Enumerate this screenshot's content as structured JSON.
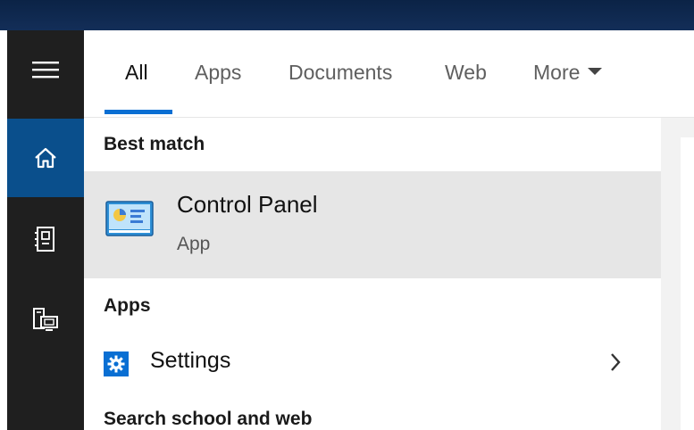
{
  "nav": {
    "items": [
      {
        "name": "hamburger-menu"
      },
      {
        "name": "home",
        "active": true
      },
      {
        "name": "notebook"
      },
      {
        "name": "devices"
      }
    ]
  },
  "tabs": [
    {
      "label": "All",
      "active": true
    },
    {
      "label": "Apps"
    },
    {
      "label": "Documents"
    },
    {
      "label": "Web"
    },
    {
      "label": "More"
    }
  ],
  "results": {
    "best_match_heading": "Best match",
    "best_match": {
      "title": "Control Panel",
      "subtitle": "App",
      "icon": "control-panel-icon"
    },
    "apps_heading": "Apps",
    "apps": [
      {
        "label": "Settings",
        "icon": "gear-icon"
      }
    ],
    "web_heading": "Search school and web"
  },
  "colors": {
    "accent": "#0a6fd3",
    "rail_bg": "#1f1f1f",
    "rail_active": "#0a4f8c",
    "highlight": "#e6e6e6",
    "topbar": "#0b2346"
  }
}
